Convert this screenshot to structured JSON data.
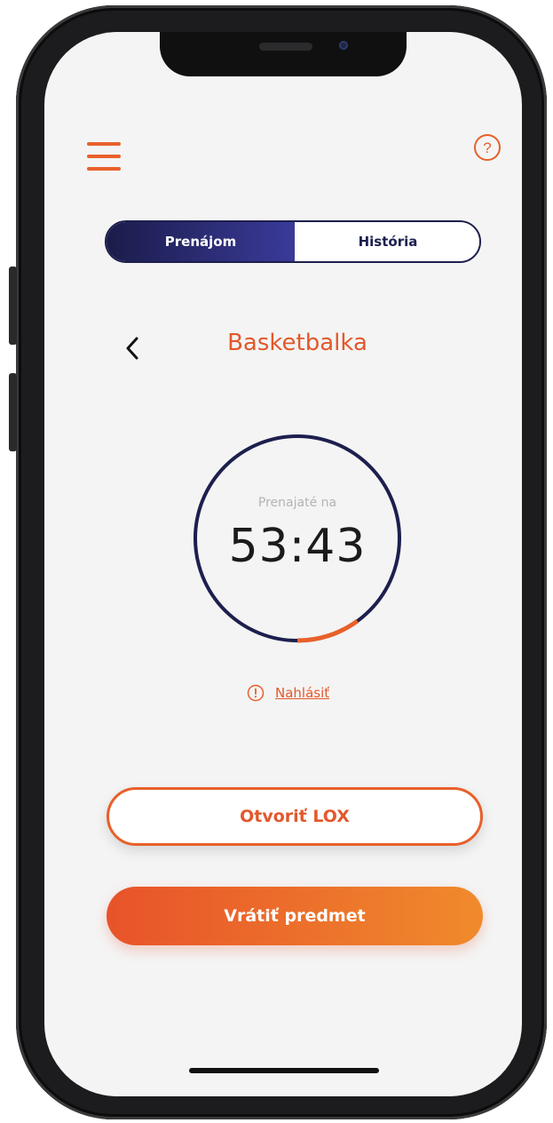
{
  "tabs": [
    {
      "label": "Prenájom",
      "active": true
    },
    {
      "label": "História",
      "active": false
    }
  ],
  "item": {
    "title": "Basketbalka"
  },
  "timer": {
    "label": "Prenajaté na",
    "value": "53:43",
    "progress_fraction": 0.1
  },
  "report": {
    "label": "Nahlásiť"
  },
  "actions": {
    "open_label": "Otvoriť LOX",
    "return_label": "Vrátiť predmet"
  },
  "colors": {
    "accent": "#e8602a",
    "navy": "#1d1f4e",
    "background": "#f4f4f4"
  },
  "icons": {
    "menu": "menu-icon",
    "help": "help-icon",
    "back": "back-chevron-icon",
    "warning": "warning-icon"
  }
}
